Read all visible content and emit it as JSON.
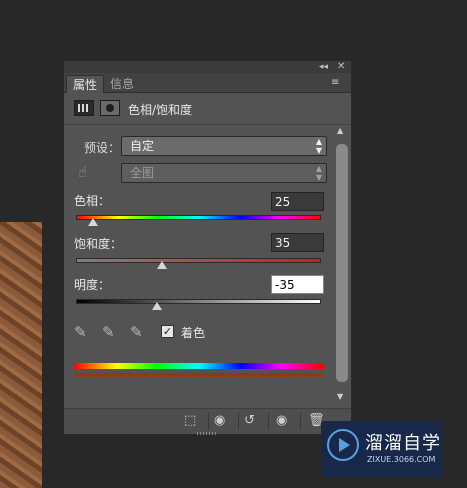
{
  "tabs": {
    "properties": "属性",
    "info": "信息"
  },
  "header": {
    "title": "色相/饱和度"
  },
  "preset": {
    "label": "预设：",
    "value": "自定"
  },
  "channel": {
    "value": "全图"
  },
  "hue": {
    "label": "色相：",
    "value": "25",
    "slider_position": 0.07
  },
  "saturation": {
    "label": "饱和度：",
    "value": "35",
    "slider_position": 0.35
  },
  "lightness": {
    "label": "明度：",
    "value": "-35",
    "slider_position": 0.33
  },
  "colorize": {
    "label": "着色",
    "checked": true,
    "check_glyph": "✓"
  },
  "window_controls": {
    "collapse": "◂◂",
    "close": "✕",
    "menu": "≡"
  },
  "footer_icons": [
    "clip-to-layer-icon",
    "view-previous-state-icon",
    "reset-icon",
    "visibility-icon",
    "delete-icon"
  ],
  "watermark": {
    "title": "溜溜自学",
    "subtitle": "ZIXUE.3066.COM"
  },
  "colors": {
    "panel_bg": "#535353",
    "app_bg": "#282828",
    "input_bg": "#3a3a3a",
    "accent": "#5a8fd8"
  }
}
